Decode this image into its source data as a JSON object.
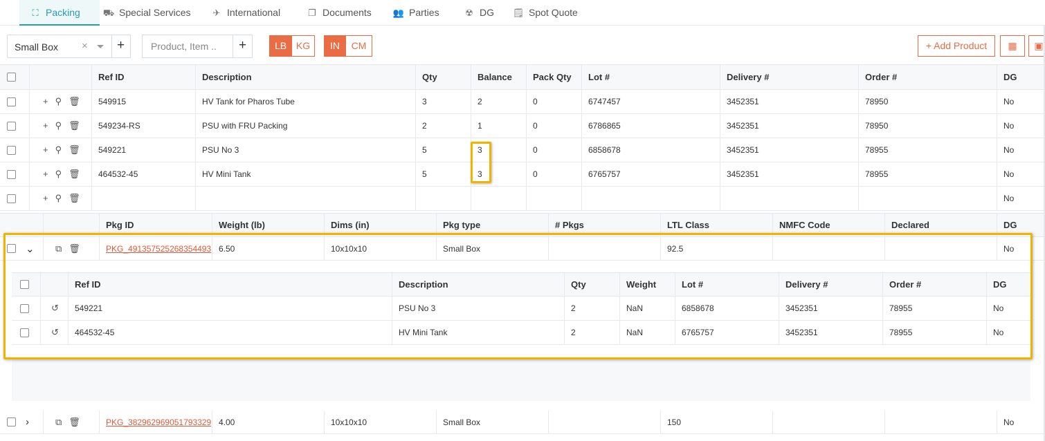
{
  "tabs": [
    {
      "label": "Packing",
      "icon": "packing-icon",
      "glyph": "⛶",
      "active": true
    },
    {
      "label": "Special Services",
      "icon": "services-icon",
      "glyph": "⛟",
      "active": false
    },
    {
      "label": "International",
      "icon": "plane-icon",
      "glyph": "✈",
      "active": false
    },
    {
      "label": "Documents",
      "icon": "documents-icon",
      "glyph": "❐",
      "active": false
    },
    {
      "label": "Parties",
      "icon": "users-icon",
      "glyph": "👥",
      "active": false
    },
    {
      "label": "DG",
      "icon": "hazard-icon",
      "glyph": "☢",
      "active": false
    },
    {
      "label": "Spot Quote",
      "icon": "quote-icon",
      "glyph": "🗒",
      "active": false
    }
  ],
  "toolbar": {
    "package_select": "Small Box",
    "product_placeholder": "Product, Item ..",
    "units_weight": [
      "LB",
      "KG"
    ],
    "units_dim": [
      "IN",
      "CM"
    ],
    "add_product": "+ Add Product"
  },
  "items_table": {
    "columns": [
      "Ref ID",
      "Description",
      "Qty",
      "Balance",
      "Pack Qty",
      "Lot #",
      "Delivery #",
      "Order #",
      "DG"
    ],
    "rows": [
      [
        "549915",
        "HV Tank for Pharos Tube",
        "3",
        "2",
        "0",
        "6747457",
        "3452351",
        "78950",
        "No"
      ],
      [
        "549234-RS",
        "PSU with FRU Packing",
        "2",
        "1",
        "0",
        "6786865",
        "3452351",
        "78950",
        "No"
      ],
      [
        "549221",
        "PSU No 3",
        "5",
        "3",
        "0",
        "6858678",
        "3452351",
        "78955",
        "No"
      ],
      [
        "464532-45",
        "HV Mini Tank",
        "5",
        "3",
        "0",
        "6765757",
        "3452351",
        "78955",
        "No"
      ],
      [
        "",
        "",
        "",
        "",
        "",
        "",
        "",
        "",
        "No"
      ]
    ]
  },
  "packages_table": {
    "columns": [
      "Pkg ID",
      "Weight (lb)",
      "Dims (in)",
      "Pkg type",
      "# Pkgs",
      "LTL Class",
      "NMFC Code",
      "Declared",
      "DG"
    ],
    "rows": [
      {
        "cells": [
          "PKG_491357525268354493",
          "6.50",
          "10x10x10",
          "Small Box",
          "",
          "92.5",
          "",
          "",
          "No"
        ],
        "expanded": true
      },
      {
        "cells": [
          "PKG_382962969051793329",
          "4.00",
          "10x10x10",
          "Small Box",
          "",
          "150",
          "",
          "",
          "No"
        ],
        "expanded": false
      }
    ]
  },
  "package_contents": {
    "columns": [
      "Ref ID",
      "Description",
      "Qty",
      "Weight",
      "Lot #",
      "Delivery #",
      "Order #",
      "DG"
    ],
    "rows": [
      [
        "549221",
        "PSU No 3",
        "2",
        "NaN",
        "6858678",
        "3452351",
        "78955",
        "No"
      ],
      [
        "464532-45",
        "HV Mini Tank",
        "2",
        "NaN",
        "6765757",
        "3452351",
        "78955",
        "No"
      ]
    ]
  },
  "colors": {
    "accent": "#ea6c45",
    "tab_active": "#2a9bb0",
    "highlight": "#f0b400"
  }
}
